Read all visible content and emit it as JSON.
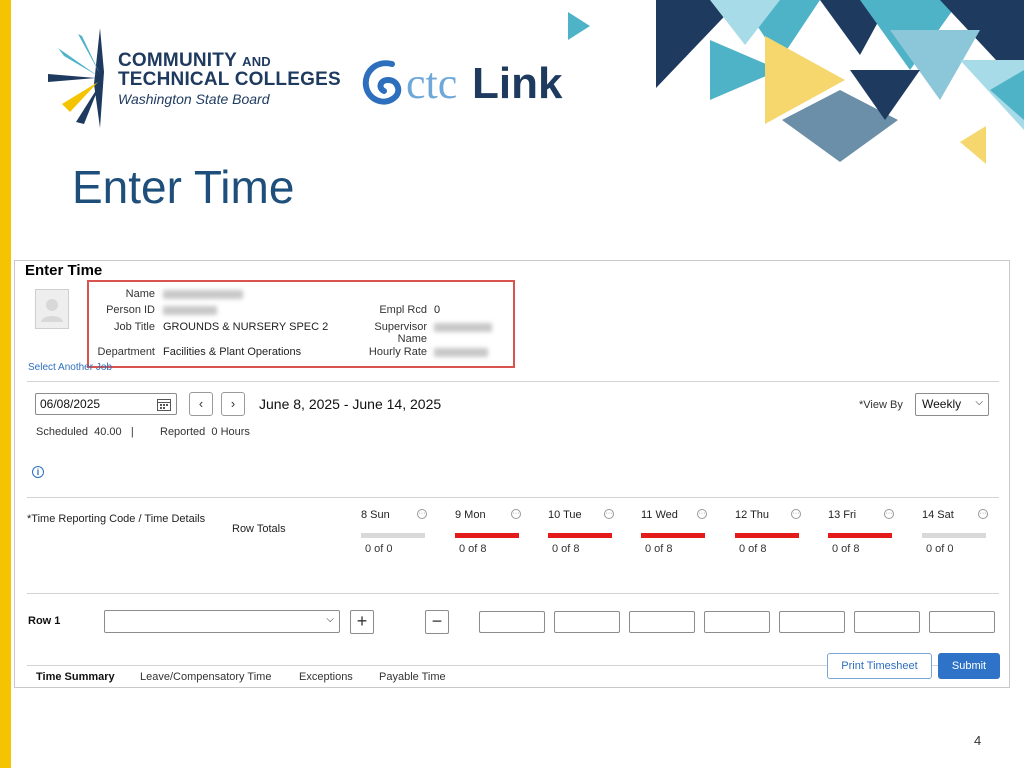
{
  "branding": {
    "org_line1": "COMMUNITY",
    "org_and": "AND",
    "org_line2": "TECHNICAL COLLEGES",
    "org_line3": "Washington State Board",
    "product_ctc": "ctc",
    "product_link": "Link",
    "accent": "#f5c400",
    "navy": "#1e3a5f"
  },
  "slide": {
    "title": "Enter Time",
    "page_number": "4"
  },
  "panel": {
    "title": "Enter Time",
    "labels": {
      "name": "Name",
      "person_id": "Person ID",
      "job_title": "Job Title",
      "department": "Department",
      "empl_rcd": "Empl Rcd",
      "supervisor_1": "Supervisor",
      "supervisor_2": "Name",
      "hourly_rate": "Hourly Rate"
    },
    "values": {
      "job_title": "GROUNDS & NURSERY SPEC 2",
      "department": "Facilities & Plant Operations",
      "empl_rcd": "0"
    },
    "select_another_job": "Select Another Job",
    "date_value": "06/08/2025",
    "range": "June 8, 2025 - June 14, 2025",
    "view_by_label": "*View By",
    "view_by_value": "Weekly",
    "scheduled_label": "Scheduled",
    "scheduled_value": "40.00",
    "reported_label": "Reported",
    "reported_value": "0 Hours",
    "trc_header": "*Time Reporting Code / Time Details",
    "row_totals": "Row Totals",
    "row1_label": "Row 1",
    "days": [
      {
        "label": "8 Sun",
        "sub": "0 of 0",
        "highlight": false
      },
      {
        "label": "9 Mon",
        "sub": "0 of 8",
        "highlight": true
      },
      {
        "label": "10 Tue",
        "sub": "0 of 8",
        "highlight": true
      },
      {
        "label": "11 Wed",
        "sub": "0 of 8",
        "highlight": true
      },
      {
        "label": "12 Thu",
        "sub": "0 of 8",
        "highlight": true
      },
      {
        "label": "13 Fri",
        "sub": "0 of 8",
        "highlight": true
      },
      {
        "label": "14 Sat",
        "sub": "0 of 0",
        "highlight": false
      }
    ],
    "tabs": [
      "Time Summary",
      "Leave/Compensatory Time",
      "Exceptions",
      "Payable Time"
    ],
    "print_button": "Print Timesheet",
    "submit_button": "Submit",
    "highlight_color": "#e31b1b",
    "button_blue": "#2e73c8"
  }
}
